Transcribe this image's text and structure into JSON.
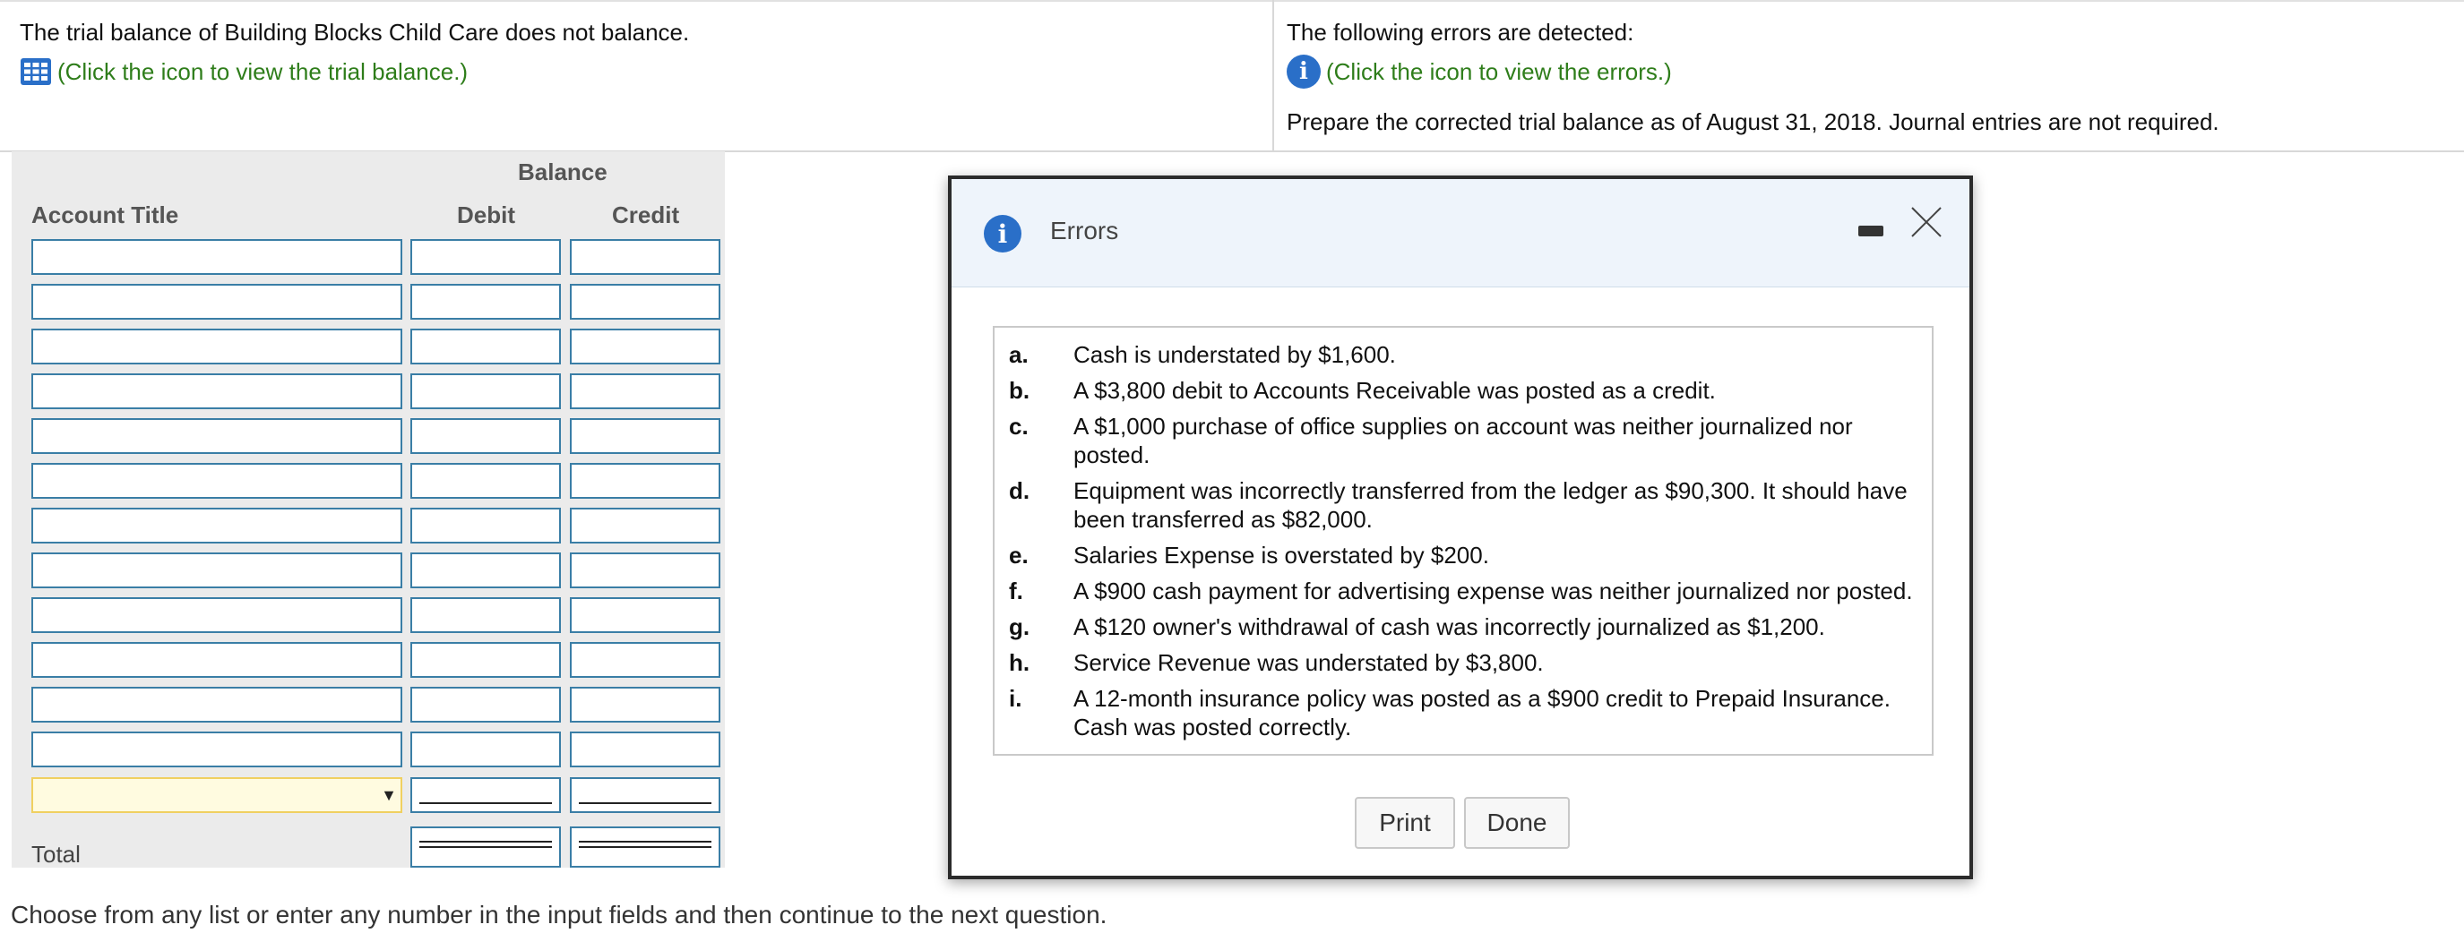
{
  "header": {
    "left_text": "The trial balance of Building Blocks Child Care does not balance.",
    "left_link": "(Click the icon to view the trial balance.)",
    "right_text": "The following errors are detected:",
    "right_link": "(Click the icon to view the errors.)",
    "instruction": "Prepare the corrected trial balance as of August 31, 2018. Journal entries are not required."
  },
  "worksheet": {
    "balance_heading": "Balance",
    "col_account": "Account Title",
    "col_debit": "Debit",
    "col_credit": "Credit",
    "total_label": "Total"
  },
  "modal": {
    "title": "Errors",
    "print_label": "Print",
    "done_label": "Done",
    "errors": [
      {
        "letter": "a.",
        "text": "Cash is understated by $1,600."
      },
      {
        "letter": "b.",
        "text": "A $3,800 debit to Accounts Receivable was posted as a credit."
      },
      {
        "letter": "c.",
        "text": "A $1,000 purchase of office supplies on account was neither journalized nor posted."
      },
      {
        "letter": "d.",
        "text": "Equipment was incorrectly transferred from the ledger as $90,300. It should have been transferred as $82,000."
      },
      {
        "letter": "e.",
        "text": "Salaries Expense is overstated by $200."
      },
      {
        "letter": "f.",
        "text": "A $900 cash payment for advertising expense was neither journalized nor posted."
      },
      {
        "letter": "g.",
        "text": "A $120 owner's withdrawal of cash was incorrectly journalized as $1,200."
      },
      {
        "letter": "h.",
        "text": "Service Revenue was understated by $3,800."
      },
      {
        "letter": "i.",
        "text": "A 12-month insurance policy was posted as a $900 credit to Prepaid Insurance. Cash was posted correctly."
      }
    ]
  },
  "footer": "Choose from any list or enter any number in the input fields and then continue to the next question.",
  "colors": {
    "link": "#2e7d1a",
    "info": "#2a6fc8",
    "input_border": "#3a7ea6"
  }
}
